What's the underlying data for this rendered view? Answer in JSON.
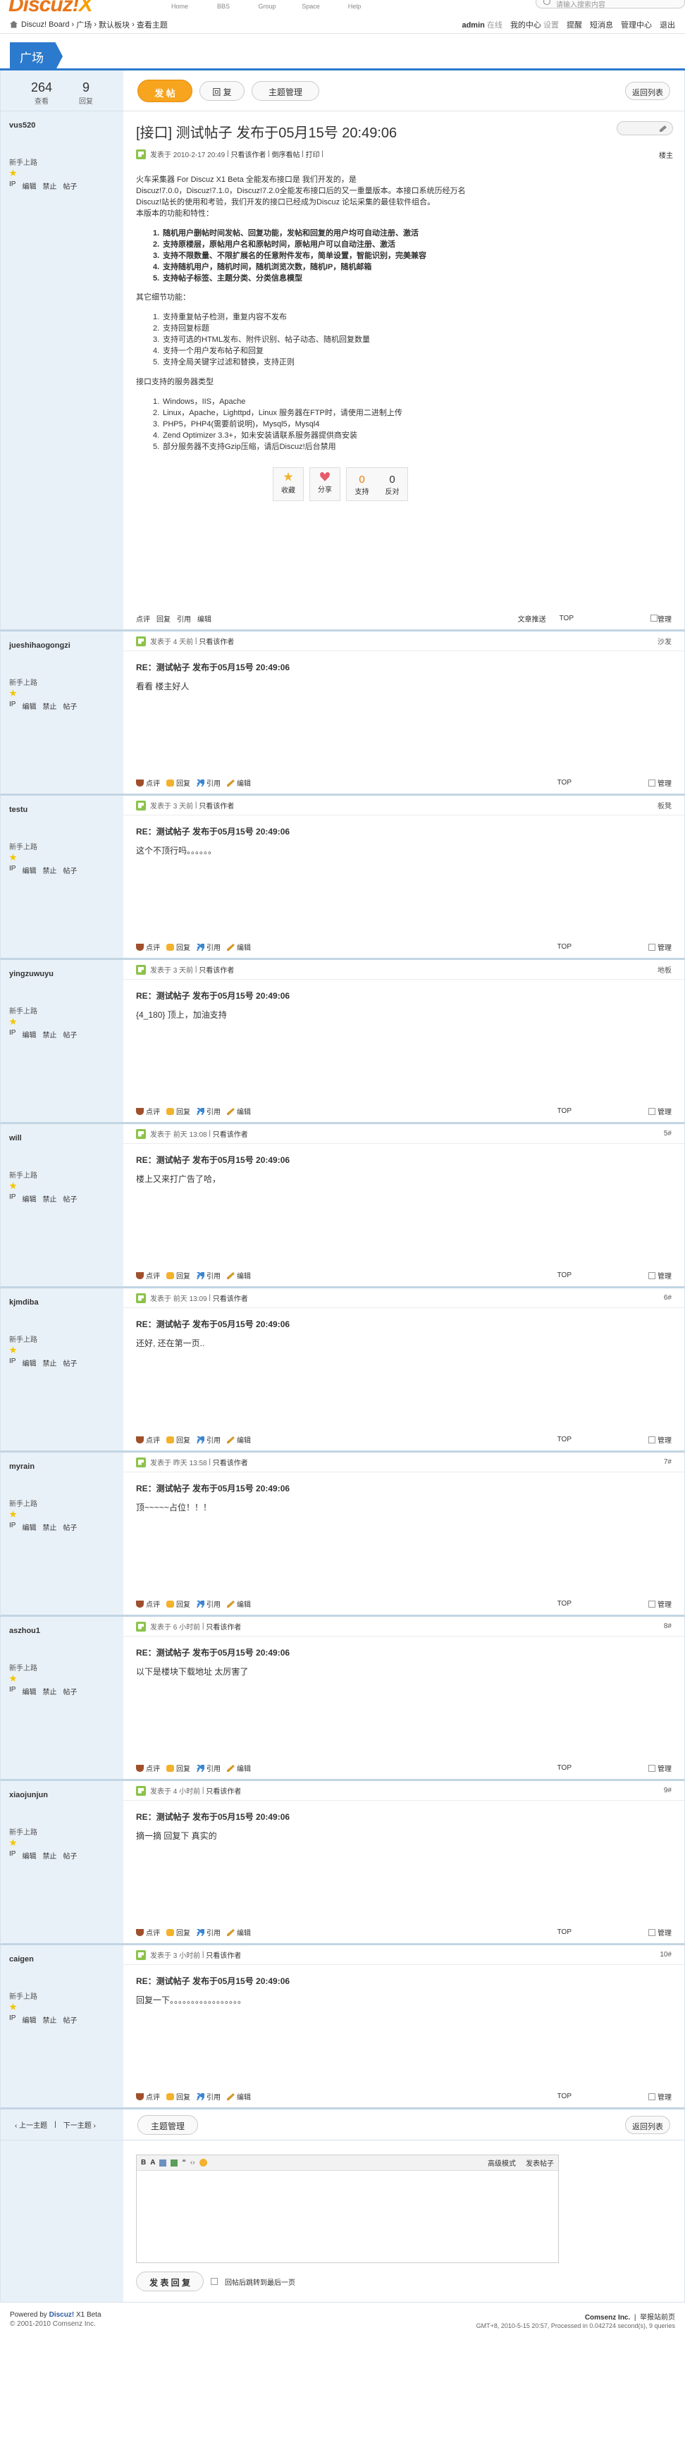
{
  "header": {
    "logo_text": "Discuz!",
    "logo_x": "X",
    "nav": [
      "Home",
      "BBS",
      "Group",
      "Space",
      "Help"
    ],
    "search_placeholder": "请输入搜索内容"
  },
  "crumb": {
    "items": [
      "Discuz! Board",
      "广场",
      "默认板块",
      "查看主题"
    ],
    "user": "admin",
    "status": "在线",
    "links": [
      "我的中心",
      "设置",
      "提醒",
      "短消息",
      "管理中心",
      "退出"
    ]
  },
  "forum": {
    "tag": "广场"
  },
  "stats": {
    "views": "264",
    "views_label": "查看",
    "replies": "9",
    "replies_label": "回复"
  },
  "actions": {
    "post": "发 帖",
    "reply": "回 复",
    "manage": "主题管理",
    "back": "返回列表"
  },
  "thread": {
    "author": "vus520",
    "group": "新手上路",
    "user_actions": [
      "IP",
      "编辑",
      "禁止",
      "帖子"
    ],
    "title": "[接口] 测试帖子 发布于05月15号 20:49:06",
    "meta": [
      "发表于 2010-2-17 20:49",
      "只看该作者",
      "倒序看帖",
      "打印"
    ],
    "louzhu": "楼主",
    "intro": [
      "火车采集器 For Discuz X1 Beta 全能发布接口是 我们开发的，是",
      "Discuz!7.0.0，Discuz!7.1.0，Discuz!7.2.0全能发布接口后的又一重量版本。本接口系统历经万名",
      "Discuz!站长的使用和考验，我们开发的接口已经成为Discuz 论坛采集的最佳软件组合。",
      "本版本的功能和特性："
    ],
    "features": [
      "随机用户删帖时间发帖、回复功能，发帖和回复的用户均可自动注册、激活",
      "支持原楼层，原帖用户名和原帖时间，原帖用户可以自动注册、激活",
      "支持不限数量、不限扩展名的任意附件发布，简单设置，智能识别，完美兼容",
      "支持随机用户，随机时间，随机浏览次数，随机IP，随机邮箱",
      "支持帖子标签、主题分类、分类信息模型"
    ],
    "other_label": "其它细节功能：",
    "details": [
      "支持重复帖子检测，重复内容不发布",
      "支持回复标题",
      "支持可选的HTML发布、附件识别、帖子动态、随机回复数量",
      "支持一个用户发布帖子和回复",
      "支持全局关键字过滤和替换，支持正则"
    ],
    "servers_label": "接口支持的服务器类型",
    "servers": [
      "Windows，IIS，Apache",
      "Linux，Apache，Lighttpd，Linux 服务器在FTP时，请使用二进制上传",
      "PHP5，PHP4(需要前说明)，Mysql5，Mysql4",
      "Zend Optimizer 3.3+，如未安装请联系服务器提供商安装",
      "部分服务器不支持Gzip压缩，请后Discuz!后台禁用"
    ],
    "vote": {
      "fav": "收藏",
      "share": "分享",
      "support_n": "0",
      "support": "支持",
      "oppose_n": "0",
      "oppose": "反对"
    },
    "foot": {
      "comment": "点评",
      "reply": "回复",
      "quote": "引用",
      "edit": "编辑",
      "recommend": "文章推送",
      "top": "TOP",
      "manage": "管理"
    }
  },
  "posts": [
    {
      "author": "jueshihaogongzi",
      "time": "发表于 4 天前",
      "only": "只看该作者",
      "floor": "沙发",
      "title": "RE：测试帖子 发布于05月15号 20:49:06",
      "body": "看看 楼主好人"
    },
    {
      "author": "testu",
      "time": "发表于 3 天前",
      "only": "只看该作者",
      "floor": "板凳",
      "title": "RE：测试帖子 发布于05月15号 20:49:06",
      "body": "这个不顶行吗。。。。。。"
    },
    {
      "author": "yingzuwuyu",
      "time": "发表于 3 天前",
      "only": "只看该作者",
      "floor": "地板",
      "title": "RE：测试帖子 发布于05月15号 20:49:06",
      "body": "{4_180} 顶上，加油支持"
    },
    {
      "author": "will",
      "time": "发表于 前天 13:08",
      "only": "只看该作者",
      "floor": "5#",
      "title": "RE：测试帖子 发布于05月15号 20:49:06",
      "body": "楼上又来打广告了哈，"
    },
    {
      "author": "kjmdiba",
      "time": "发表于 前天 13:09",
      "only": "只看该作者",
      "floor": "6#",
      "title": "RE：测试帖子 发布于05月15号 20:49:06",
      "body": "还好, 还在第一页.."
    },
    {
      "author": "myrain",
      "time": "发表于 昨天 13:58",
      "only": "只看该作者",
      "floor": "7#",
      "title": "RE：测试帖子 发布于05月15号 20:49:06",
      "body": "顶~~~~~占位！！！"
    },
    {
      "author": "aszhou1",
      "time": "发表于 6 小时前",
      "only": "只看该作者",
      "floor": "8#",
      "title": "RE：测试帖子 发布于05月15号 20:49:06",
      "body": "以下是楼块下载地址 太厉害了"
    },
    {
      "author": "xiaojunjun",
      "time": "发表于 4 小时前",
      "only": "只看该作者",
      "floor": "9#",
      "title": "RE：测试帖子 发布于05月15号 20:49:06",
      "body": "摘一摘 回复下 真实的"
    },
    {
      "author": "caigen",
      "time": "发表于 3 小时前",
      "only": "只看该作者",
      "floor": "10#",
      "title": "RE：测试帖子 发布于05月15号 20:49:06",
      "body": "回复一下。。。。。。。。。。。。。。。。。"
    }
  ],
  "user_group": "新手上路",
  "user_actions": [
    "IP",
    "编辑",
    "禁止",
    "帖子"
  ],
  "post_foot": {
    "comment": "点评",
    "reply": "回复",
    "quote": "引用",
    "edit": "编辑",
    "top": "TOP",
    "manage": "管理"
  },
  "bottom_nav": {
    "prev": "上一主题",
    "next": "下一主题",
    "manage": "主题管理",
    "back": "返回列表"
  },
  "editor": {
    "advanced": "高级模式",
    "post": "发表帖子",
    "submit": "发 表 回 复",
    "checkbox": "回帖后跳转到最后一页"
  },
  "footer": {
    "powered": "Powered by",
    "brand": "Discuz!",
    "version": "X1 Beta",
    "copy": "© 2001-2010 Comsenz Inc.",
    "company": "Comsenz Inc.",
    "links": "举报站前页",
    "processed": "GMT+8, 2010-5-15 20:57, Processed in 0.042724 second(s), 9 queries"
  }
}
